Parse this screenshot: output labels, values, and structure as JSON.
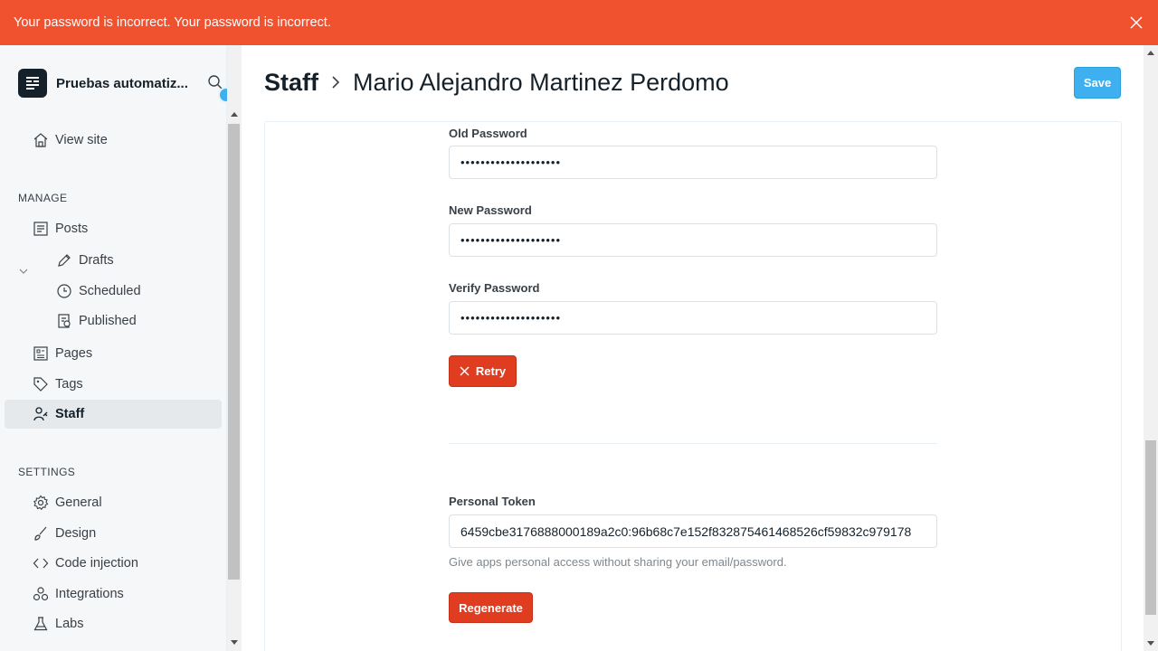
{
  "alert": {
    "message": "Your password is incorrect. Your password is incorrect."
  },
  "brand": {
    "name": "Pruebas automatiz..."
  },
  "nav": {
    "view_site": "View site",
    "manage_label": "MANAGE",
    "posts": "Posts",
    "drafts": "Drafts",
    "scheduled": "Scheduled",
    "published": "Published",
    "pages": "Pages",
    "tags": "Tags",
    "staff": "Staff",
    "settings_label": "SETTINGS",
    "general": "General",
    "design": "Design",
    "code_injection": "Code injection",
    "integrations": "Integrations",
    "labs": "Labs"
  },
  "header": {
    "breadcrumb": "Staff",
    "name": "Mario Alejandro Martinez Perdomo",
    "save_label": "Save"
  },
  "form": {
    "old_password_label": "Old Password",
    "old_password_value": "••••••••••••••••••••",
    "new_password_label": "New Password",
    "new_password_value": "••••••••••••••••••••",
    "verify_password_label": "Verify Password",
    "verify_password_value": "••••••••••••••••••••",
    "retry_label": "Retry",
    "token_label": "Personal Token",
    "token_value": "6459cbe3176888000189a2c0:96b68c7e152f832875461468526cf59832c979178",
    "token_help": "Give apps personal access without sharing your email/password.",
    "regenerate_label": "Regenerate"
  },
  "colors": {
    "alert": "#f05230",
    "save": "#3eb0ef",
    "danger": "#e03c20"
  }
}
